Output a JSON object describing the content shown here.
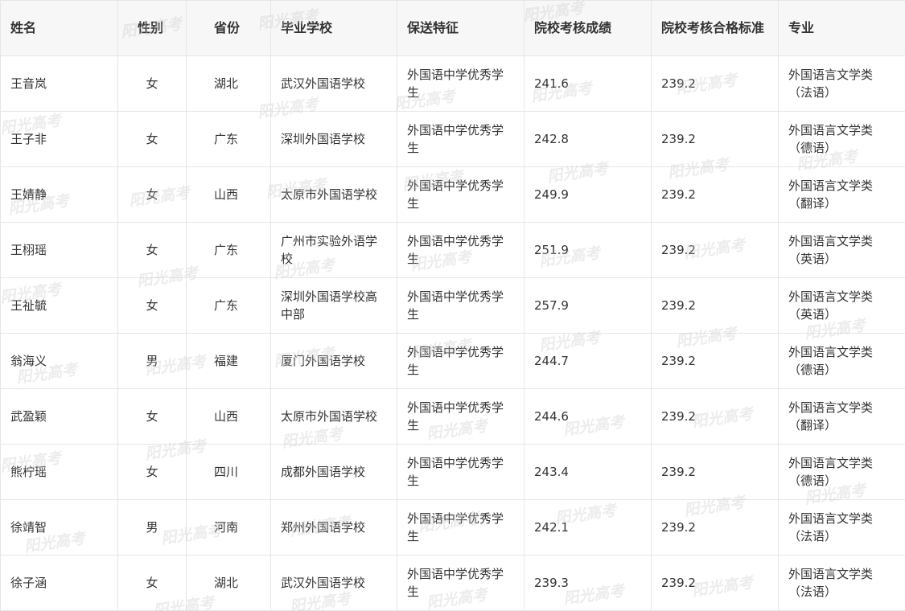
{
  "table": {
    "headers": [
      "姓名",
      "性别",
      "省份",
      "毕业学校",
      "保送特征",
      "院校考核成绩",
      "院校考核合格标准",
      "专业"
    ],
    "rows": [
      [
        "王音岚",
        "女",
        "湖北",
        "武汉外国语学校",
        "外国语中学优秀学生",
        "241.6",
        "239.2",
        "外国语言文学类（法语）"
      ],
      [
        "王子非",
        "女",
        "广东",
        "深圳外国语学校",
        "外国语中学优秀学生",
        "242.8",
        "239.2",
        "外国语言文学类（德语）"
      ],
      [
        "王婧静",
        "女",
        "山西",
        "太原市外国语学校",
        "外国语中学优秀学生",
        "249.9",
        "239.2",
        "外国语言文学类（翻译）"
      ],
      [
        "王栩瑶",
        "女",
        "广东",
        "广州市实验外语学校",
        "外国语中学优秀学生",
        "251.9",
        "239.2",
        "外国语言文学类（英语）"
      ],
      [
        "王祉毓",
        "女",
        "广东",
        "深圳外国语学校高中部",
        "外国语中学优秀学生",
        "257.9",
        "239.2",
        "外国语言文学类（英语）"
      ],
      [
        "翁海义",
        "男",
        "福建",
        "厦门外国语学校",
        "外国语中学优秀学生",
        "244.7",
        "239.2",
        "外国语言文学类（德语）"
      ],
      [
        "武盈颖",
        "女",
        "山西",
        "太原市外国语学校",
        "外国语中学优秀学生",
        "244.6",
        "239.2",
        "外国语言文学类（翻译）"
      ],
      [
        "熊柠瑶",
        "女",
        "四川",
        "成都外国语学校",
        "外国语中学优秀学生",
        "243.4",
        "239.2",
        "外国语言文学类（德语）"
      ],
      [
        "徐靖智",
        "男",
        "河南",
        "郑州外国语学校",
        "外国语中学优秀学生",
        "242.1",
        "239.2",
        "外国语言文学类（法语）"
      ],
      [
        "徐子涵",
        "女",
        "湖北",
        "武汉外国语学校",
        "外国语中学优秀学生",
        "239.3",
        "239.2",
        "外国语言文学类（法语）"
      ]
    ]
  },
  "watermark": {
    "text": "阳光高考",
    "color": "#c8c8c8"
  }
}
